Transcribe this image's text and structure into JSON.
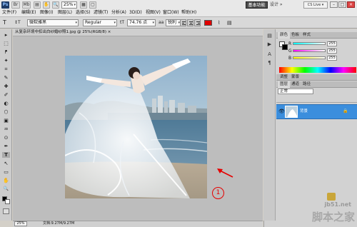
{
  "app": {
    "logo": "Ps",
    "toolbar_buttons": [
      "Br",
      "Mb"
    ],
    "zoom_display": "25%",
    "workspace_active": "基本功能",
    "workspace_other": "设计 »",
    "cs_live": "CS Live ▾"
  },
  "menu": [
    "文件(F)",
    "编辑(E)",
    "图像(I)",
    "图层(L)",
    "选择(S)",
    "滤镜(T)",
    "分析(A)",
    "3D(D)",
    "视图(V)",
    "窗口(W)",
    "帮助(H)"
  ],
  "options": {
    "tool_icon": "T",
    "orient_icon": "↕T",
    "font_family": "微软雅黑",
    "font_style": "Regular",
    "size_icon": "tT",
    "font_size": "74.76 点",
    "aa_icon": "aa",
    "antialias": "锐利",
    "text_color": "#e00000"
  },
  "document": {
    "tab_title": "从复杂环境中扣出白纱婚纱照1.jpg @ 25%(RGB/8) ×",
    "status_zoom": "25%",
    "status_doc": "文档:9.27M/9.27M"
  },
  "annotation": {
    "label": "1",
    "color": "#e60000"
  },
  "tools": [
    "▸",
    "⬚",
    "ᖰ",
    "✦",
    "⌗",
    "✎",
    "✚",
    "✐",
    "◐",
    "⬡",
    "▣",
    "♒",
    "⊙",
    "✒",
    "T",
    "↖",
    "▭",
    "✋",
    "🔍"
  ],
  "panels": {
    "color_tabs": [
      "颜色",
      "色板",
      "样式"
    ],
    "channels": [
      {
        "label": "R",
        "value": "255"
      },
      {
        "label": "G",
        "value": "255"
      },
      {
        "label": "B",
        "value": "255"
      }
    ],
    "adjust_tabs": [
      "调整",
      "蒙版"
    ],
    "layers_tabs": [
      "图层",
      "通道",
      "路径"
    ],
    "blend_mode": "正常",
    "layer_name": "背景"
  },
  "watermark": {
    "url": "jb51.net",
    "name": "脚本之家"
  }
}
